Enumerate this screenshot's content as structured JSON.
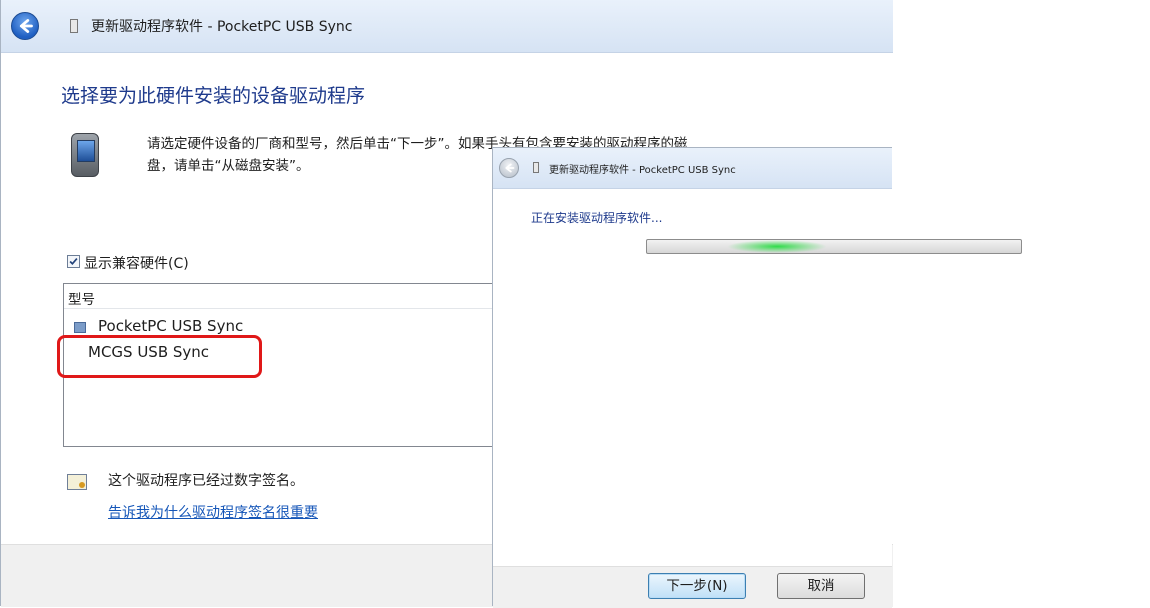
{
  "window_main": {
    "title": "更新驱动程序软件 - PocketPC USB Sync",
    "heading": "选择要为此硬件安装的设备驱动程序",
    "instruction_line1": "请选定硬件设备的厂商和型号，然后单击“下一步”。如果手头有包含要安装的驱动程序的磁",
    "instruction_line2": "盘，请单击“从磁盘安装”。",
    "show_compatible_label": "显示兼容硬件(C)",
    "show_compatible_checked": true,
    "model_header": "型号",
    "models": [
      "PocketPC USB Sync",
      "MCGS USB Sync"
    ],
    "signed_text": "这个驱动程序已经过数字签名。",
    "why_link": "告诉我为什么驱动程序签名很重要"
  },
  "window_progress": {
    "title": "更新驱动程序软件 - PocketPC USB Sync",
    "status": "正在安装驱动程序软件...",
    "next_button": "下一步(N)",
    "cancel_button": "取消"
  },
  "icons": {
    "back": "back-arrow-icon",
    "device": "pda-device-icon",
    "certificate": "certificate-icon"
  },
  "colors": {
    "heading": "#1e3a8c",
    "link": "#1556b8",
    "highlight": "#e01818",
    "progress_glow": "#2fdc4a"
  }
}
